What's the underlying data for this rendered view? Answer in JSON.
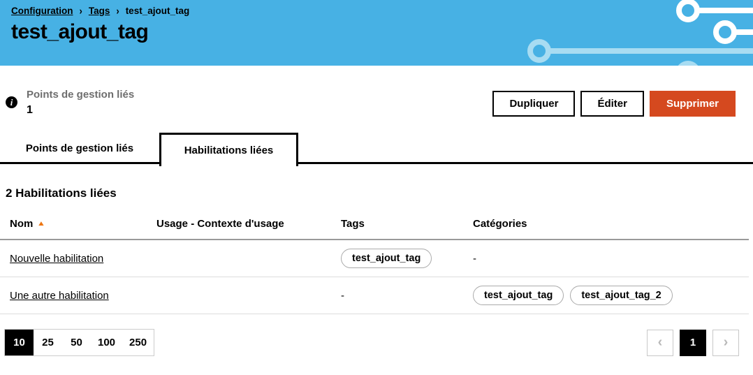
{
  "colors": {
    "header_bg": "#47B1E4",
    "header_deco_light": "#A8DCF2",
    "danger": "#D5491F",
    "sort_arrow": "#ED7612",
    "muted_label": "#6E6E6E"
  },
  "icons": {
    "info": "i",
    "sort_asc": "▲",
    "chevron_left": "‹",
    "chevron_right": "›"
  },
  "breadcrumb": {
    "separator": "›",
    "items": [
      {
        "label": "Configuration"
      },
      {
        "label": "Tags"
      },
      {
        "label": "test_ajout_tag"
      }
    ]
  },
  "page_title": "test_ajout_tag",
  "summary": {
    "label": "Points de gestion liés",
    "value": "1"
  },
  "actions": {
    "duplicate": "Dupliquer",
    "edit": "Éditer",
    "delete": "Supprimer"
  },
  "tabs": [
    {
      "label": "Points de gestion liés",
      "active": false
    },
    {
      "label": "Habilitations liées",
      "active": true
    }
  ],
  "section": {
    "heading": "2 Habilitations liées"
  },
  "table": {
    "columns": [
      "Nom",
      "Usage - Contexte d'usage",
      "Tags",
      "Catégories"
    ],
    "sorted_column": "Nom",
    "sort_direction": "asc",
    "rows": [
      {
        "nom": "Nouvelle habilitation",
        "usage": "",
        "tags": [
          "test_ajout_tag"
        ],
        "categories_text": "-"
      },
      {
        "nom": "Une autre habilitation",
        "usage": "",
        "tags_text": "-",
        "categories": [
          "test_ajout_tag",
          "test_ajout_tag_2"
        ]
      }
    ]
  },
  "pagination": {
    "page_sizes": [
      "10",
      "25",
      "50",
      "100",
      "250"
    ],
    "selected_size": "10",
    "current_page": "1"
  }
}
